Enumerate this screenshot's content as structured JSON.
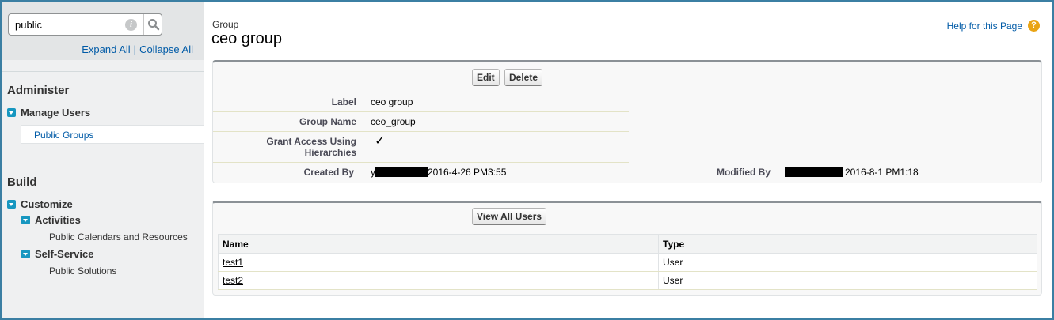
{
  "sidebar": {
    "search": {
      "value": "public",
      "placeholder": ""
    },
    "expand_all": "Expand All",
    "separator": "|",
    "collapse_all": "Collapse All",
    "sections": [
      {
        "title": "Administer",
        "items": [
          {
            "label": "Manage Users",
            "children": [
              "Public Groups"
            ]
          }
        ]
      },
      {
        "title": "Build",
        "items": [
          {
            "label": "Customize",
            "children": [
              {
                "label": "Activities",
                "children": [
                  "Public Calendars and Resources"
                ]
              },
              {
                "label": "Self-Service",
                "children": [
                  "Public Solutions"
                ]
              }
            ]
          }
        ]
      }
    ]
  },
  "header": {
    "object_type": "Group",
    "title": "ceo group",
    "help_link": "Help for this Page"
  },
  "detail": {
    "buttons": {
      "edit": "Edit",
      "delete": "Delete"
    },
    "fields": {
      "label": {
        "label": "Label",
        "value": "ceo group"
      },
      "group_name": {
        "label": "Group Name",
        "value": "ceo_group"
      },
      "grant_access": {
        "label_line1": "Grant Access Using",
        "label_line2": "Hierarchies",
        "value": "✓"
      },
      "created_by": {
        "label": "Created By",
        "prefix": "y",
        "value": "2016-4-26 PM3:55"
      },
      "modified_by": {
        "label": "Modified By",
        "value": "2016-8-1 PM1:18"
      }
    }
  },
  "members": {
    "view_all_button": "View All Users",
    "columns": [
      "Name",
      "Type"
    ],
    "rows": [
      {
        "name": "test1",
        "type": "User"
      },
      {
        "name": "test2",
        "type": "User"
      }
    ]
  },
  "colors": {
    "link": "#015ba7",
    "tree_toggle": "#1797c0",
    "frame": "#3b7fa3",
    "help_icon": "#e9a415"
  },
  "icons": {
    "search": "search-icon",
    "info": "info-icon",
    "help": "help-icon",
    "tree_toggle": "expanded-triangle-icon"
  }
}
